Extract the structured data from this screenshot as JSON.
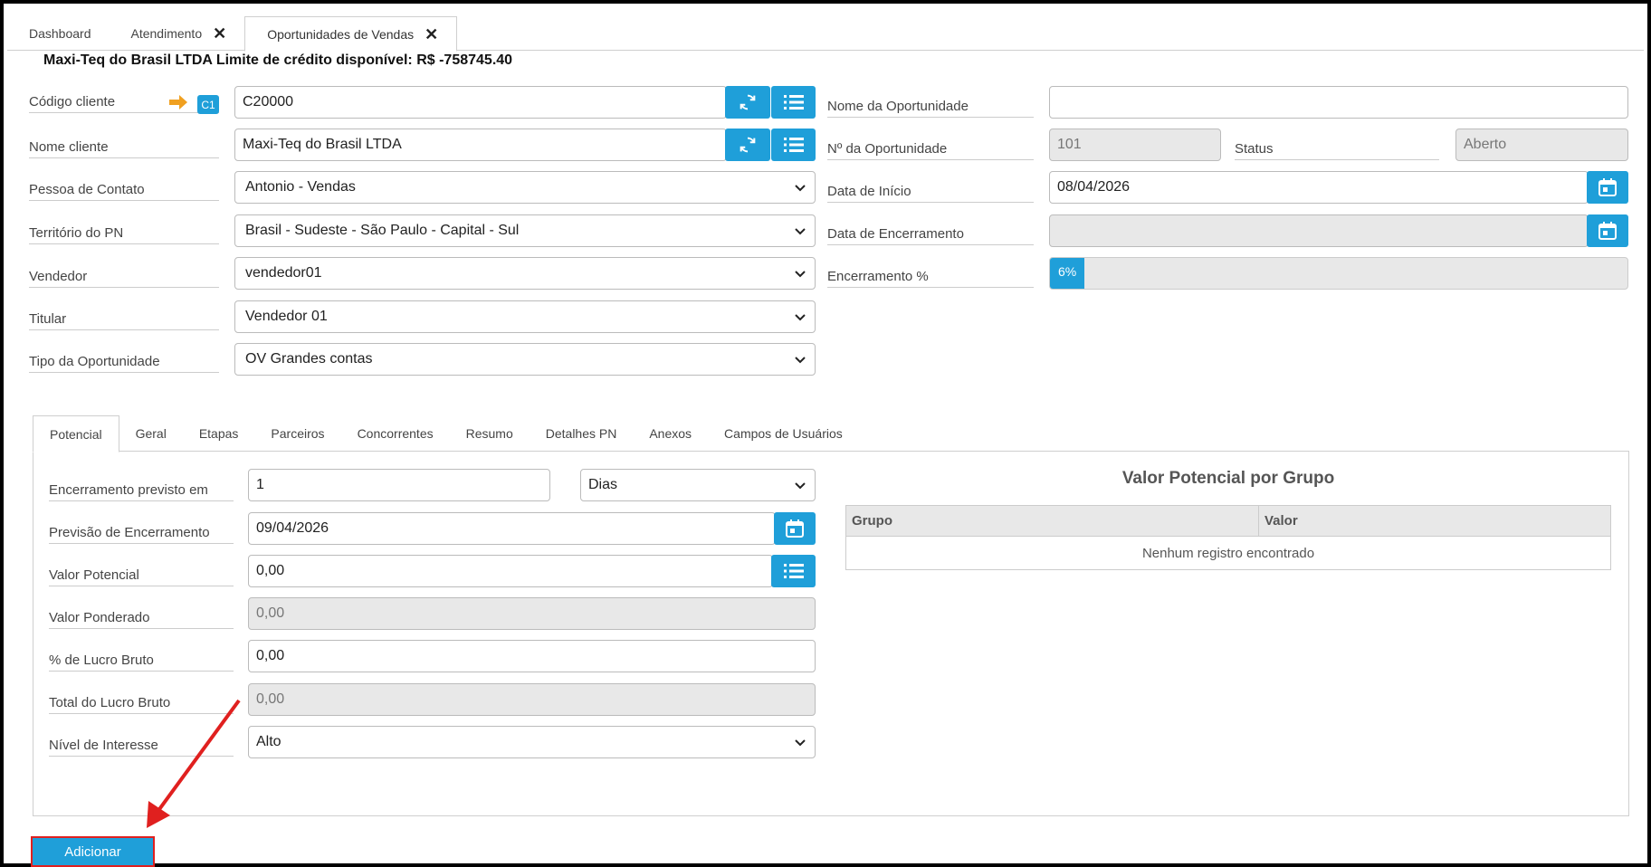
{
  "tabs": [
    {
      "label": "Dashboard",
      "closable": false
    },
    {
      "label": "Atendimento",
      "closable": true
    },
    {
      "label": "Oportunidades de Vendas",
      "closable": true,
      "active": true
    }
  ],
  "header": {
    "subtitle": "Maxi-Teq do Brasil LTDA Limite de crédito disponível: R$ -758745.40"
  },
  "left_form": {
    "codigo_cliente": {
      "label": "Código cliente",
      "badge": "C1",
      "value": "C20000"
    },
    "nome_cliente": {
      "label": "Nome cliente",
      "value": "Maxi-Teq do Brasil LTDA"
    },
    "pessoa_contato": {
      "label": "Pessoa de Contato",
      "value": "Antonio - Vendas"
    },
    "territorio": {
      "label": "Território do PN",
      "value": "Brasil - Sudeste - São Paulo - Capital - Sul"
    },
    "vendedor": {
      "label": "Vendedor",
      "value": "vendedor01"
    },
    "titular": {
      "label": "Titular",
      "value": "Vendedor 01"
    },
    "tipo": {
      "label": "Tipo da Oportunidade",
      "value": "OV Grandes contas"
    }
  },
  "right_form": {
    "nome_oportunidade": {
      "label": "Nome da Oportunidade",
      "value": ""
    },
    "num_oportunidade": {
      "label": "Nº da Oportunidade",
      "value": "101"
    },
    "status": {
      "label": "Status",
      "value": "Aberto"
    },
    "data_inicio": {
      "label": "Data de Início",
      "value": "08/04/2026"
    },
    "data_encerramento": {
      "label": "Data de Encerramento",
      "value": ""
    },
    "encerramento_pct": {
      "label": "Encerramento %",
      "value": "6%",
      "fraction": 0.06
    }
  },
  "detail_tabs": [
    "Potencial",
    "Geral",
    "Etapas",
    "Parceiros",
    "Concorrentes",
    "Resumo",
    "Detalhes PN",
    "Anexos",
    "Campos de Usuários"
  ],
  "potencial": {
    "encerramento_previsto": {
      "label": "Encerramento previsto em",
      "value": "1",
      "unit": "Dias"
    },
    "previsao_encerramento": {
      "label": "Previsão de Encerramento",
      "value": "09/04/2026"
    },
    "valor_potencial": {
      "label": "Valor Potencial",
      "value": "0,00"
    },
    "valor_ponderado": {
      "label": "Valor Ponderado",
      "value": "0,00"
    },
    "pct_lucro_bruto": {
      "label": "% de Lucro Bruto",
      "value": "0,00"
    },
    "total_lucro_bruto": {
      "label": "Total do Lucro Bruto",
      "value": "0,00"
    },
    "nivel_interesse": {
      "label": "Nível de Interesse",
      "value": "Alto"
    }
  },
  "grupo_table": {
    "title": "Valor Potencial por Grupo",
    "columns": [
      "Grupo",
      "Valor"
    ],
    "empty_text": "Nenhum registro encontrado"
  },
  "footer": {
    "add_label": "Adicionar"
  },
  "colors": {
    "accent": "#1f9fd9",
    "highlight": "#e0201f",
    "arrow_orange": "#f0a020"
  }
}
